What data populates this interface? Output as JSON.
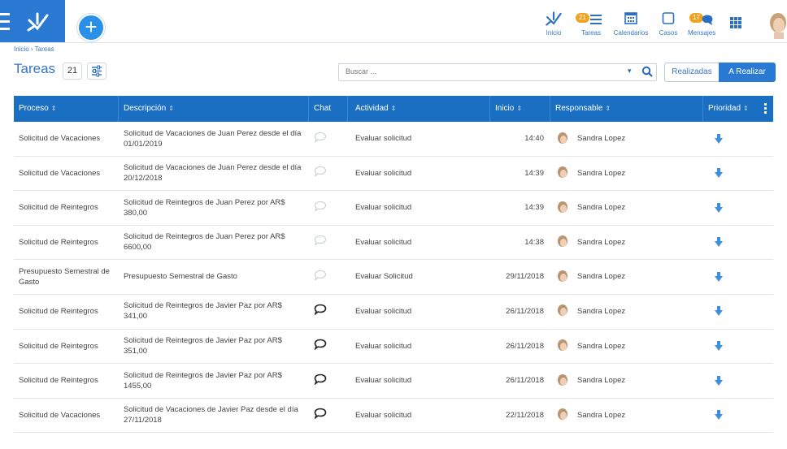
{
  "nav": {
    "items": [
      {
        "label": "Inicio",
        "icon": "home-icon"
      },
      {
        "label": "Tareas",
        "icon": "tasks-icon",
        "badge": "21"
      },
      {
        "label": "Calendarios",
        "icon": "calendar-icon"
      },
      {
        "label": "Casos",
        "icon": "cases-icon"
      },
      {
        "label": "Mensajes",
        "icon": "messages-icon",
        "badge": "17"
      }
    ]
  },
  "breadcrumb": "Inicio › Tareas",
  "page": {
    "title": "Tareas",
    "count": "21"
  },
  "search": {
    "placeholder": "Buscar ..."
  },
  "toggle": {
    "done": "Realizadas",
    "todo": "A Realizar"
  },
  "colors": {
    "primary": "#2a7ad4",
    "header": "#1b6fc2",
    "badge": "#f0a321"
  },
  "table": {
    "headers": {
      "proceso": "Proceso",
      "descripcion": "Descripción",
      "chat": "Chat",
      "actividad": "Actividad",
      "inicio": "Inicio",
      "responsable": "Responsable",
      "prioridad": "Prioridad"
    },
    "rows": [
      {
        "proceso": "Solicitud de Vacaciones",
        "descripcion": "Solicitud de Vacaciones de Juan Perez desde el día 01/01/2019",
        "chat": "empty",
        "actividad": "Evaluar solicitud",
        "inicio": "14:40",
        "responsable": "Sandra Lopez"
      },
      {
        "proceso": "Solicitud de Vacaciones",
        "descripcion": "Solicitud de Vacaciones de Juan Perez desde el día 20/12/2018",
        "chat": "empty",
        "actividad": "Evaluar solicitud",
        "inicio": "14:39",
        "responsable": "Sandra Lopez"
      },
      {
        "proceso": "Solicitud de Reintegros",
        "descripcion": "Solicitud de Reintegros de Juan Perez por AR$ 380,00",
        "chat": "empty",
        "actividad": "Evaluar solicitud",
        "inicio": "14:39",
        "responsable": "Sandra Lopez"
      },
      {
        "proceso": "Solicitud de Reintegros",
        "descripcion": "Solicitud de Reintegros de Juan Perez por AR$ 6600,00",
        "chat": "empty",
        "actividad": "Evaluar solicitud",
        "inicio": "14:38",
        "responsable": "Sandra Lopez"
      },
      {
        "proceso": "Presupuesto Semestral de Gasto",
        "descripcion": "Presupuesto Semestral de Gasto",
        "chat": "empty",
        "actividad": "Evaluar Solicitud",
        "inicio": "29/11/2018",
        "responsable": "Sandra Lopez"
      },
      {
        "proceso": "Solicitud de Reintegros",
        "descripcion": "Solicitud de Reintegros de Javier Paz por AR$ 341,00",
        "chat": "active",
        "actividad": "Evaluar solicitud",
        "inicio": "26/11/2018",
        "responsable": "Sandra Lopez"
      },
      {
        "proceso": "Solicitud de Reintegros",
        "descripcion": "Solicitud de Reintegros de Javier Paz por AR$ 351,00",
        "chat": "active",
        "actividad": "Evaluar solicitud",
        "inicio": "26/11/2018",
        "responsable": "Sandra Lopez"
      },
      {
        "proceso": "Solicitud de Reintegros",
        "descripcion": "Solicitud de Reintegros de Javier Paz por AR$ 1455,00",
        "chat": "active",
        "actividad": "Evaluar solicitud",
        "inicio": "26/11/2018",
        "responsable": "Sandra Lopez"
      },
      {
        "proceso": "Solicitud de Vacaciones",
        "descripcion": "Solicitud de Vacaciones de Javier Paz desde el día 27/11/2018",
        "chat": "active",
        "actividad": "Evaluar solicitud",
        "inicio": "22/11/2018",
        "responsable": "Sandra Lopez"
      }
    ]
  }
}
